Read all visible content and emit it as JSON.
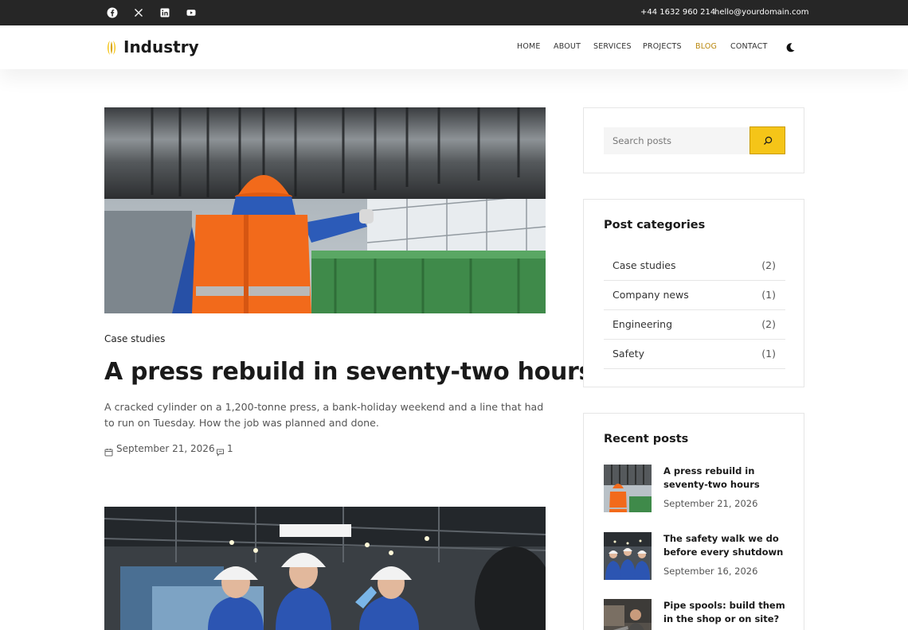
{
  "topbar": {
    "social": [
      "facebook-icon",
      "x-icon",
      "linkedin-icon",
      "youtube-icon"
    ],
    "phone": "+44 1632 960 214",
    "email": "hello@yourdomain.com"
  },
  "header": {
    "logo_text": "Industry",
    "nav": [
      {
        "label": "HOME",
        "active": false
      },
      {
        "label": "ABOUT",
        "active": false
      },
      {
        "label": "SERVICES",
        "active": false
      },
      {
        "label": "PROJECTS",
        "active": false
      },
      {
        "label": "BLOG",
        "active": true
      },
      {
        "label": "CONTACT",
        "active": false
      }
    ],
    "theme_toggle_icon": "moon-icon"
  },
  "posts": [
    {
      "category": "Case studies",
      "title": "A press rebuild in seventy-two hours",
      "excerpt": "A cracked cylinder on a 1,200-tonne press, a bank-holiday weekend and a line that had to run on Tuesday. How the job was planned and done.",
      "date": "September 21, 2026",
      "comments": "1"
    }
  ],
  "sidebar": {
    "search": {
      "placeholder": "Search posts",
      "button_icon": "search-icon"
    },
    "categories": {
      "title": "Post categories",
      "items": [
        {
          "name": "Case studies",
          "count": "(2)"
        },
        {
          "name": "Company news",
          "count": "(1)"
        },
        {
          "name": "Engineering",
          "count": "(2)"
        },
        {
          "name": "Safety",
          "count": "(1)"
        }
      ]
    },
    "recent": {
      "title": "Recent posts",
      "items": [
        {
          "title": "A press rebuild in seventy-two hours",
          "date": "September 21, 2026"
        },
        {
          "title": "The safety walk we do before every shutdown",
          "date": "September 16, 2026"
        },
        {
          "title": "Pipe spools: build them in the shop or on site?",
          "date": ""
        }
      ]
    }
  },
  "colors": {
    "accent": "#f5c518",
    "nav_active": "#b8860b",
    "topbar_bg": "#262626",
    "vest_orange": "#f26a1b"
  }
}
